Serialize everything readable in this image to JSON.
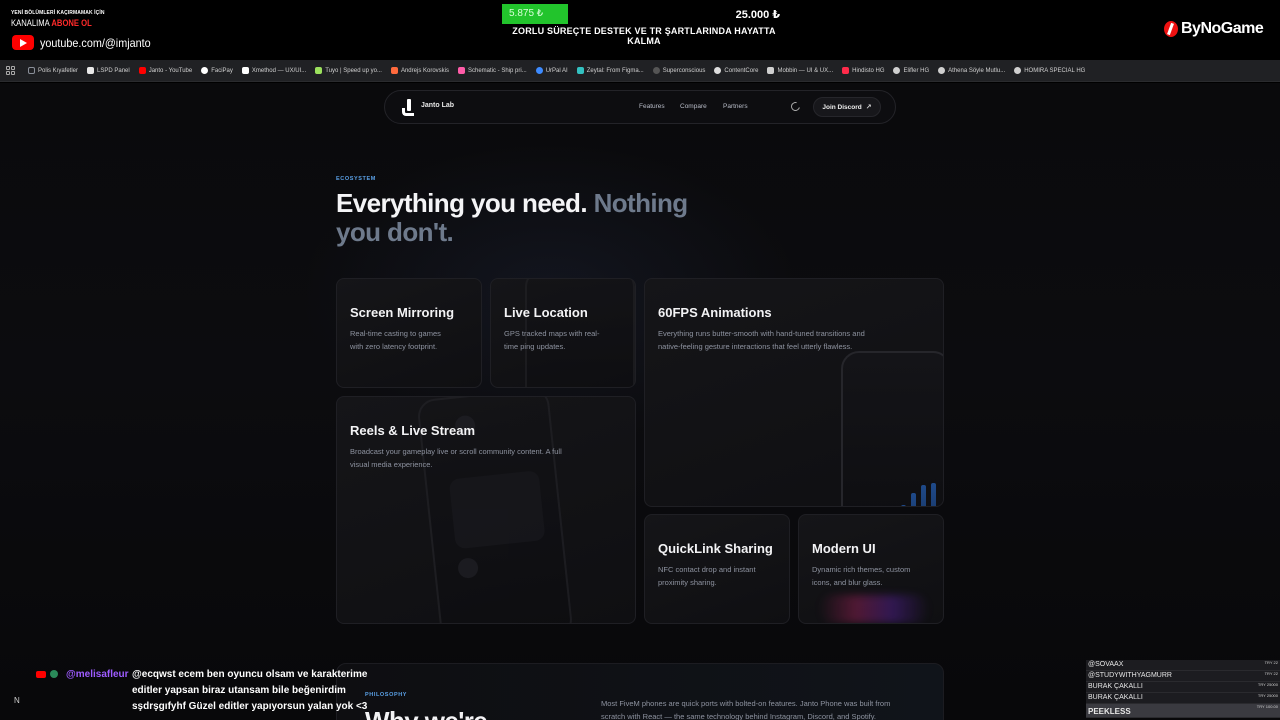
{
  "overlay": {
    "yt_promo_line1": "YENİ BÖLÜMLERİ KAÇIRMAMAK İÇİN",
    "yt_promo_line2a": "KANALIMA ",
    "yt_promo_line2b": "ABONE OL",
    "yt_handle": "youtube.com/@imjanto",
    "goal_current": "5.875 ₺",
    "goal_target": "25.000 ₺",
    "goal_progress": 0.235,
    "goal_caption": "ZORLU SÜREÇTE DESTEK VE TR ŞARTLARINDA HAYATTA KALMA",
    "sponsor_logo": "ByNoGame",
    "colors": {
      "goal_green": "#22c42c",
      "yt_red": "#ff0000"
    }
  },
  "bookmarks": [
    {
      "label": "Polis Kıyafetler",
      "icon": "folder-icon",
      "color": "#8a8f99"
    },
    {
      "label": "LSPD Panel",
      "icon": "lspd-icon",
      "color": "#e8e8e8"
    },
    {
      "label": "Janto - YouTube",
      "icon": "youtube-icon",
      "color": "#ff0000"
    },
    {
      "label": "FaciPay",
      "icon": "facipay-icon",
      "color": "#ffffff"
    },
    {
      "label": "Xmethod — UX/UI...",
      "icon": "x-icon",
      "color": "#ffffff"
    },
    {
      "label": "Tuyo | Speed up yo...",
      "icon": "tuyo-icon",
      "color": "#9be15d"
    },
    {
      "label": "Andrejs Korovskis",
      "icon": "andrejs-icon",
      "color": "#ff6a3d"
    },
    {
      "label": "Schematic - Ship pri...",
      "icon": "schematic-icon",
      "color": "#ff5ca8"
    },
    {
      "label": "UrPal AI",
      "icon": "urpal-icon",
      "color": "#3d8bff"
    },
    {
      "label": "Zeytal: From Figma...",
      "icon": "zeytal-icon",
      "color": "#33c1c1"
    },
    {
      "label": "Superconscious",
      "icon": "superconscious-icon",
      "color": "#555555"
    },
    {
      "label": "ContentCore",
      "icon": "contentcore-icon",
      "color": "#dddddd"
    },
    {
      "label": "Mobbin — UI & UX...",
      "icon": "mobbin-icon",
      "color": "#cfcfcf"
    },
    {
      "label": "Hindisto HG",
      "icon": "hindisto-icon",
      "color": "#ff2b4a"
    },
    {
      "label": "Elifler HG",
      "icon": "elifler-icon",
      "color": "#cfcfcf"
    },
    {
      "label": "Athena Söyle Mutlu...",
      "icon": "athena-icon",
      "color": "#cfcfcf"
    },
    {
      "label": "HOMIRA SPECIAL HG",
      "icon": "homira-icon",
      "color": "#cfcfcf"
    }
  ],
  "nav": {
    "brand": "Janto Lab",
    "links": [
      "Features",
      "Compare",
      "Partners"
    ],
    "cta": "Join Discord",
    "cta_icon": "arrow-up-right-icon",
    "theme_icon": "moon-icon"
  },
  "hero": {
    "eyebrow": "ECOSYSTEM",
    "headline_white": "Everything you need.",
    "headline_muted_1": "Nothing",
    "headline_muted_2": "you don't."
  },
  "cards": [
    {
      "title": "Screen Mirroring",
      "desc": [
        "Real-time casting to games",
        "with zero latency footprint."
      ]
    },
    {
      "title": "Live Location",
      "desc": [
        "GPS tracked maps with real-",
        "time ping updates."
      ]
    },
    {
      "title": "60FPS Animations",
      "desc": [
        "Everything runs butter-smooth with hand-tuned transitions and",
        "native-feeling gesture interactions that feel utterly flawless."
      ]
    },
    {
      "title": "Reels & Live Stream",
      "desc": [
        "Broadcast your gameplay live or scroll community content. A full",
        "visual media experience."
      ]
    },
    {
      "title": "QuickLink Sharing",
      "desc": [
        "NFC contact drop and instant",
        "proximity sharing."
      ]
    },
    {
      "title": "Modern UI",
      "desc": [
        "Dynamic rich themes, custom",
        "icons, and blur glass."
      ]
    }
  ],
  "philosophy": {
    "eyebrow": "PHILOSOPHY",
    "heading": "Why we're",
    "body": [
      "Most FiveM phones are quick ports with bolted-on features. Janto Phone was built from",
      "scratch with React — the same technology behind Instagram, Discord, and Spotify."
    ]
  },
  "chat": {
    "user": "@melisafleur",
    "lines": [
      "@ecqwst ecem ben oyuncu olsam ve karakterime",
      "editler yapsan biraz utansam bile beğenirdim",
      "sşdrşgıfyhf Güzel editler yapıyorsun yalan yok <3"
    ],
    "colors": {
      "user": "#9d5bff"
    }
  },
  "donors": [
    {
      "name": "@SOVAAX",
      "amount": "TRY 22"
    },
    {
      "name": "@STUDYWITHYAGMURR",
      "amount": "TRY 22"
    },
    {
      "name": "BURAK ÇAKALLI",
      "amount": "TRY 25000"
    },
    {
      "name": "BURAK ÇAKALLI",
      "amount": "TRY 25000"
    },
    {
      "name": "PEEKLESS",
      "amount": "TRY 100.00"
    }
  ],
  "corner_badge": "N"
}
